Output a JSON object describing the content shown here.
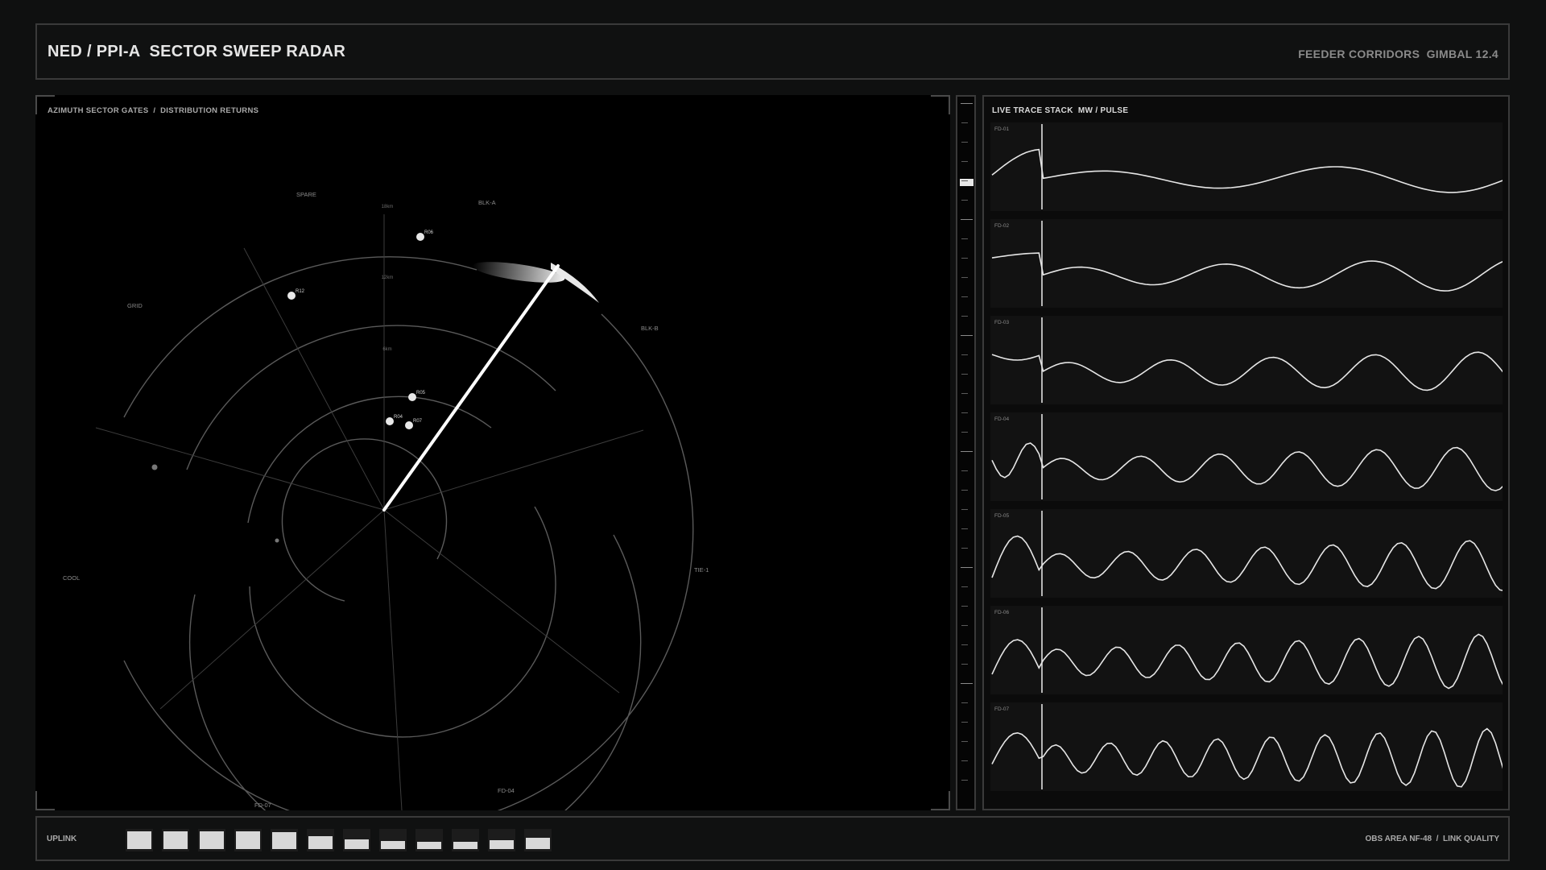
{
  "header": {
    "title": "NED / PPI-A  SECTOR SWEEP RADAR",
    "right": "FEEDER CORRIDORS  GIMBAL 12.4"
  },
  "radar": {
    "panel_label": "AZIMUTH SECTOR GATES  /  DISTRIBUTION RETURNS",
    "range_labels": [
      "6km",
      "12km",
      "18km"
    ],
    "sectors": [
      "SPARE",
      "BLK-A",
      "BLK-B",
      "GRID",
      "TIE-1",
      "COOL",
      "FD-04",
      "FD-07"
    ],
    "contacts": [
      {
        "label": "R06",
        "kind": "target"
      },
      {
        "label": "R12",
        "kind": "target"
      },
      {
        "label": "R05",
        "kind": "target"
      },
      {
        "label": "R04",
        "kind": "target"
      },
      {
        "label": "R07",
        "kind": "target"
      },
      {
        "label": "",
        "kind": "clutter"
      },
      {
        "label": "",
        "kind": "clutter"
      }
    ],
    "sweep_color": "#ffffff",
    "ring_color": "#5a5a5a"
  },
  "traces": {
    "title": "LIVE TRACE STACK  MW / PULSE",
    "items": [
      {
        "label": "FD-01"
      },
      {
        "label": "FD-02"
      },
      {
        "label": "FD-03"
      },
      {
        "label": "FD-04"
      },
      {
        "label": "FD-05"
      },
      {
        "label": "FD-06"
      },
      {
        "label": "FD-07"
      }
    ]
  },
  "slider": {
    "level": 0.11
  },
  "footer": {
    "uplink": "UPLINK",
    "right": "OBS AREA NF-48  /  LINK QUALITY",
    "bars": [
      1.0,
      1.0,
      1.0,
      1.0,
      0.95,
      0.72,
      0.55,
      0.45,
      0.4,
      0.4,
      0.5,
      0.65
    ]
  }
}
